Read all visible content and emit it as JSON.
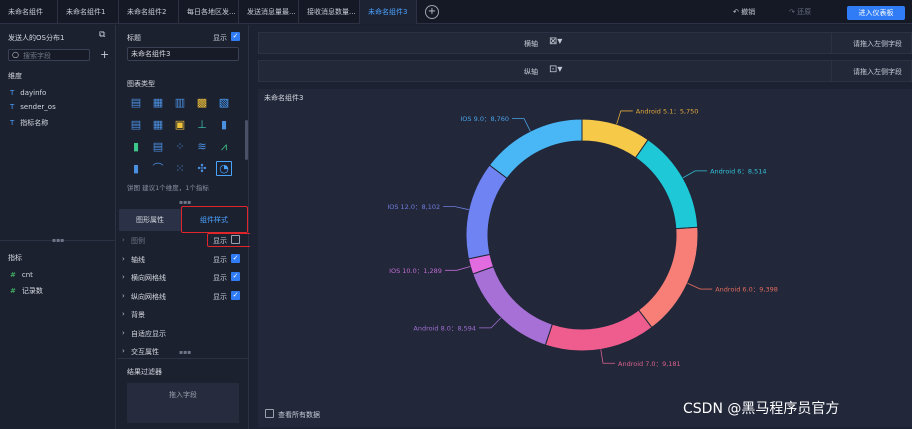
{
  "tabs": [
    {
      "label": "未命名组件",
      "active": false
    },
    {
      "label": "未命名组件1",
      "active": false
    },
    {
      "label": "未命名组件2",
      "active": false
    },
    {
      "label": "每日各地区发...",
      "active": false
    },
    {
      "label": "发送消息量最...",
      "active": false
    },
    {
      "label": "接收消息数量...",
      "active": false
    },
    {
      "label": "未命名组件3",
      "active": true
    }
  ],
  "toolbar": {
    "add_tab": "+",
    "undo": "撤销",
    "redo": "还原",
    "add_dashboard": "进入仪表板"
  },
  "left_panel": {
    "dataset_title": "发送人的OS分布1",
    "search_placeholder": "搜索字段",
    "dimensions_title": "维度",
    "dimensions": [
      {
        "icon": "T",
        "name": "dayinfo"
      },
      {
        "icon": "T",
        "name": "sender_os"
      },
      {
        "icon": "T",
        "name": "指标名称"
      }
    ],
    "measures_title": "指标",
    "measures": [
      {
        "icon": "#",
        "name": "cnt"
      },
      {
        "icon": "#",
        "name": "记录数"
      }
    ]
  },
  "mid_panel": {
    "title_label": "标题",
    "title_show": "显示",
    "title_value": "未命名组件3",
    "chart_type_label": "图表类型",
    "chart_hint": "饼图 建议1个维度，1个指标",
    "tab_attr": "图形属性",
    "tab_style": "组件样式",
    "rows": [
      {
        "label": "图例",
        "show": "显示",
        "checked": false
      },
      {
        "label": "轴线",
        "show": "显示",
        "checked": true
      },
      {
        "label": "横向网格线",
        "show": "显示",
        "checked": true
      },
      {
        "label": "纵向网格线",
        "show": "显示",
        "checked": true
      },
      {
        "label": "背景",
        "show": "",
        "checked": null
      },
      {
        "label": "自适应显示",
        "show": "",
        "checked": null
      },
      {
        "label": "交互属性",
        "show": "",
        "checked": null
      }
    ],
    "filter_title": "结果过滤器",
    "filter_drop": "拖入字段"
  },
  "shelves": [
    {
      "label": "横轴",
      "hint": "请拖入左侧字段"
    },
    {
      "label": "纵轴",
      "hint": "请拖入左侧字段"
    }
  ],
  "chart_title": "未命名组件3",
  "view_all": "查看所有数据",
  "watermark": "CSDN @黑马程序员官方",
  "chart_data": {
    "type": "pie",
    "title": "未命名组件3",
    "donut": true,
    "categories": [
      "Android 5.1",
      "Android 6",
      "Android 6.0",
      "Android 7.0",
      "Android 8.0",
      "IOS 10.0",
      "IOS 12.0",
      "IOS 9.0"
    ],
    "values": [
      5750,
      8514,
      9398,
      9181,
      8594,
      1289,
      8102,
      8760
    ],
    "labels": [
      "Android 5.1：5,750",
      "Android 6：8,514",
      "Android 6.0：9,398",
      "Android 7.0：9,181",
      "Android 8.0：8,594",
      "IOS 10.0：1,289",
      "IOS 12.0：8,102",
      "IOS 9.0：8,760"
    ],
    "colors": [
      "#f7c948",
      "#1ec8d6",
      "#f77f77",
      "#ef5d8e",
      "#a770d6",
      "#e36be0",
      "#6f84f2",
      "#49b7f5"
    ],
    "label_colors": [
      "#e0a93b",
      "#34c1d6",
      "#e06b5c",
      "#d9628c",
      "#9f6fcf",
      "#c06bd0",
      "#6f7fe0",
      "#4aa3e8"
    ]
  }
}
